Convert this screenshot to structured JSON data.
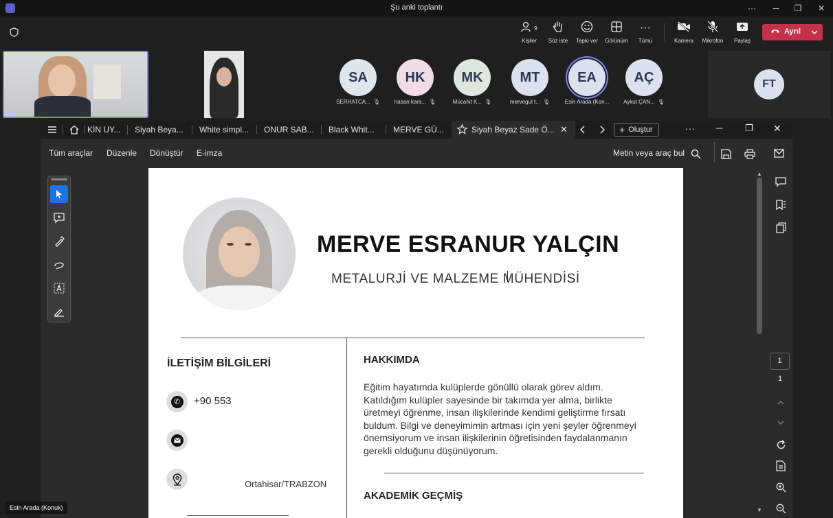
{
  "window": {
    "title": "Şu anki toplantı"
  },
  "controls": {
    "people_label": "Kişiler",
    "people_count": "9",
    "raise_label": "Söz iste",
    "react_label": "Tepki ver",
    "view_label": "Görünüm",
    "more_label": "Tümü",
    "camera_label": "Kamera",
    "mic_label": "Mikrofon",
    "share_label": "Paylaş",
    "leave_label": "Ayrıl"
  },
  "participants": [
    {
      "initials": "SA",
      "name": "SERHATCA...",
      "color": "#dfe7ee"
    },
    {
      "initials": "HK",
      "name": "hasan kara...",
      "color": "#f1dbe6"
    },
    {
      "initials": "MK",
      "name": "Mücahit K...",
      "color": "#dde7de"
    },
    {
      "initials": "MT",
      "name": "mervegul t...",
      "color": "#dbe1ee"
    },
    {
      "initials": "EA",
      "name": "Esin Arada (Kon...",
      "color": "#dbe1ee"
    },
    {
      "initials": "AÇ",
      "name": "Aykut ÇAN...",
      "color": "#dbe1ee"
    }
  ],
  "overflow_participant": {
    "initials": "FT"
  },
  "browser": {
    "tabs": [
      "KİN UY...",
      "Siyah Beya...",
      "White simpl...",
      "ONUR SAB...",
      "Black Whit...",
      "MERVE GÜ..."
    ],
    "active_tab": "Siyah Beyaz Sade Ö...",
    "create_label": "Oluştur"
  },
  "pdf_toolbar": {
    "all_tools": "Tüm araçlar",
    "edit": "Düzenle",
    "convert": "Dönüştür",
    "esign": "E-imza",
    "search": "Metin veya araç bul"
  },
  "cv": {
    "name": "MERVE ESRANUR YALÇIN",
    "title": "METALURJİ VE MALZEME MÜHENDİSİ",
    "contact_heading": "İLETİŞİM BİLGİLERİ",
    "phone": "+90 553",
    "address": "Ortahisar/TRABZON",
    "about_heading": "HAKKIMDA",
    "about_lines": [
      "Eğitim hayatımda kulüplerde gönüllü olarak görev aldım.",
      "Katıldığım kulüpler sayesinde bir takımda yer alma, birlikte",
      "üretmeyi öğrenme, insan ilişkilerinde kendimi geliştirme fırsatı",
      "buldum. Bilgi ve deneyimimin artması için yeni şeyler öğrenmeyi",
      "önemsiyorum ve insan ilişkilerinin öğretisinden faydalanmanın",
      "gerekli olduğunu düşünüyorum."
    ],
    "education_heading": "AKADEMİK GEÇMİŞ"
  },
  "page_nav": {
    "current": "1",
    "total": "1"
  },
  "presenter": "Esin Arada (Konuk)"
}
